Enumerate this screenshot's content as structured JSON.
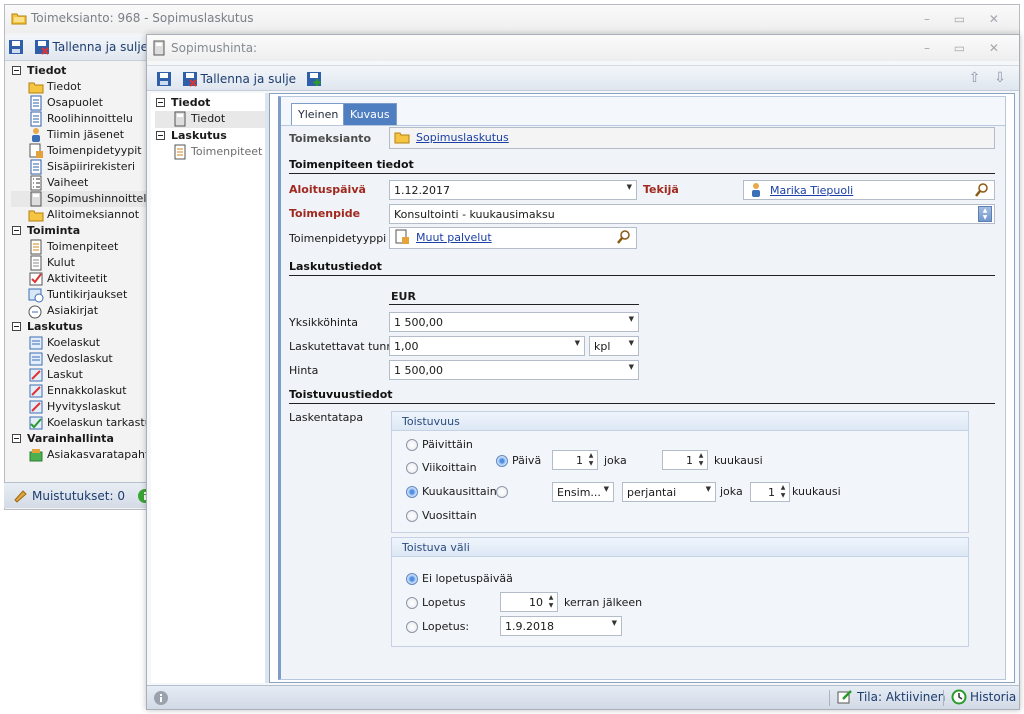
{
  "background_window": {
    "title": "Toimeksianto: 968 - Sopimuslaskutus",
    "toolbar": {
      "save_close_label": "Tallenna ja sulje"
    },
    "tree": [
      {
        "label": "Tiedot",
        "items": [
          "Tiedot",
          "Osapuolet",
          "Roolihinnoittelu",
          "Tiimin jäsenet",
          "Toimenpidetyypit",
          "Sisäpiirirekisteri",
          "Vaiheet",
          "Sopimushinnoittelu",
          "Alitoimeksiannot"
        ]
      },
      {
        "label": "Toiminta",
        "items": [
          "Toimenpiteet",
          "Kulut",
          "Aktiviteetit",
          "Tuntikirjaukset",
          "Asiakirjat"
        ]
      },
      {
        "label": "Laskutus",
        "items": [
          "Koelaskut",
          "Vedoslaskut",
          "Laskut",
          "Ennakkolaskut",
          "Hyvityslaskut",
          "Koelaskun tarkastusp"
        ]
      },
      {
        "label": "Varainhallinta",
        "items": [
          "Asiakasvaratapahtur"
        ]
      }
    ],
    "status": {
      "reminders_label": "Muistutukset: 0"
    }
  },
  "window": {
    "title": "Sopimushinta:",
    "toolbar": {
      "save_close_label": "Tallenna ja sulje"
    },
    "nav_tree": [
      {
        "label": "Tiedot",
        "items": [
          "Tiedot"
        ]
      },
      {
        "label": "Laskutus",
        "items": [
          "Toimenpiteet"
        ]
      }
    ],
    "tabs": [
      "Yleinen",
      "Kuvaus"
    ],
    "form": {
      "toimeksianto_label": "Toimeksianto",
      "toimeksianto_value": "Sopimuslaskutus",
      "section_toimenpide": "Toimenpiteen tiedot",
      "aloituspaiva_label": "Aloituspäivä",
      "aloituspaiva_value": "1.12.2017",
      "tekija_label": "Tekijä",
      "tekija_value": "Marika Tiepuoli",
      "toimenpide_label": "Toimenpide",
      "toimenpide_value": "Konsultointi - kuukausimaksu",
      "toimenpidetyyppi_label": "Toimenpidetyyppi",
      "toimenpidetyyppi_value": "Muut palvelut",
      "section_laskutus": "Laskutustiedot",
      "currency": "EUR",
      "yksikkohinta_label": "Yksikköhinta",
      "yksikkohinta_value": "1 500,00",
      "tunnit_label": "Laskutettavat tunnit",
      "tunnit_value": "1,00",
      "unit_value": "kpl",
      "hinta_label": "Hinta",
      "hinta_value": "1 500,00",
      "section_toistuvuus": "Toistuvuustiedot",
      "laskentatapa_label": "Laskentatapa"
    },
    "recurrence": {
      "title": "Toistuvuus",
      "options": [
        "Päivittäin",
        "Viikoittain",
        "Kuukausittain",
        "Vuosittain"
      ],
      "selected": "Kuukausittain",
      "daily_label": "Päivä",
      "day_value": "1",
      "every_label": "joka",
      "month_interval_value": "1",
      "months_label": "kuukausi",
      "ordinal_value": "Ensim...",
      "weekday_value": "perjantai",
      "every2_label": "joka",
      "month_interval2_value": "1",
      "months2_label": "kuukausi"
    },
    "range": {
      "title": "Toistuva väli",
      "no_end_label": "Ei lopetuspäivää",
      "end_after_label": "Lopetus",
      "occurrences_value": "10",
      "occurrences_suffix": "kerran jälkeen",
      "end_by_label": "Lopetus:",
      "end_date_value": "1.9.2018",
      "selected": "Ei lopetuspäivää"
    },
    "status": {
      "state_label": "Tila: Aktiivinen",
      "history_label": "Historia"
    }
  },
  "colors": {
    "accent": "#4f7fc0",
    "required_label": "#a0281e",
    "link": "#1a3fa6"
  }
}
